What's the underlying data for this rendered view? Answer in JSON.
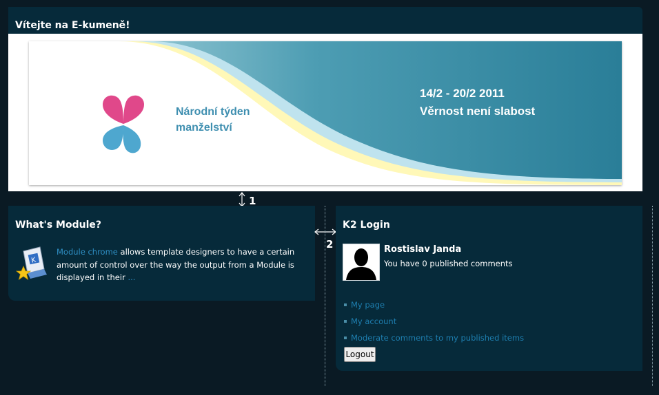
{
  "banner_panel": {
    "title": "Vítejte na E-kumeně!",
    "banner": {
      "org_text": "Národní týden manželství",
      "date": "14/2 - 20/2 2011",
      "motto": "Věrnost není slabost"
    }
  },
  "module_panel": {
    "title": "What's Module?",
    "link_text": "Module chrome",
    "body_text": " allows template designers to have a certain amount of control over the way the output from a Module is displayed in their ",
    "more_link": "..."
  },
  "login_panel": {
    "title": "K2 Login",
    "user_name": "Rostislav Janda",
    "comments_text": "You have 0 published comments",
    "menu": [
      {
        "label": "My page"
      },
      {
        "label": "My account"
      },
      {
        "label": "Moderate comments to my published items"
      }
    ],
    "logout_label": "Logout"
  },
  "annotations": {
    "vertical_gap_label": "1",
    "horizontal_gap_label": "2"
  },
  "colors": {
    "page_bg": "#0a1a24",
    "panel_bg": "#062a3a",
    "link": "#2f8fc4"
  }
}
